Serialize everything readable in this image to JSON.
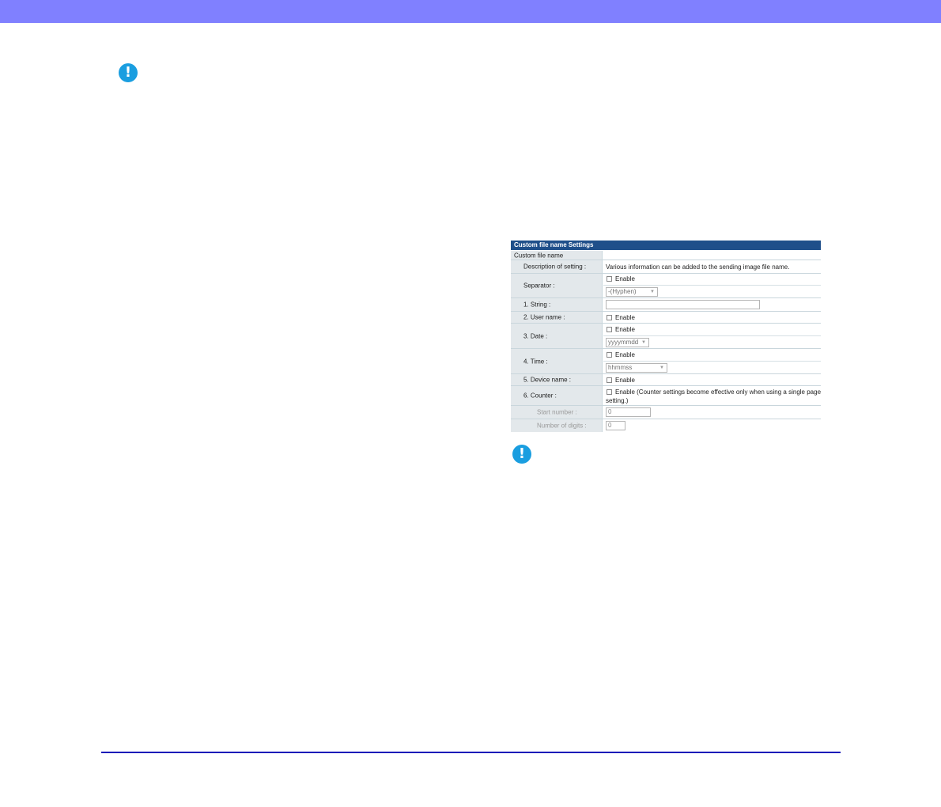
{
  "panel": {
    "title": "Custom file name Settings",
    "section_label": "Custom file name",
    "description_label": "Description of setting :",
    "description_text": "Various information can be added to the sending image file name.",
    "separator": {
      "label": "Separator :",
      "enable": "Enable",
      "selected": "-(Hyphen)"
    },
    "string": {
      "label": "1. String :",
      "value": ""
    },
    "user_name": {
      "label": "2. User name :",
      "enable": "Enable"
    },
    "date": {
      "label": "3. Date :",
      "enable": "Enable",
      "selected": "yyyymmdd"
    },
    "time": {
      "label": "4. Time :",
      "enable": "Enable",
      "selected": "hhmmss"
    },
    "device_name": {
      "label": "5. Device name :",
      "enable": "Enable"
    },
    "counter": {
      "label": "6. Counter :",
      "enable_line1": "Enable (Counter settings become effective only when using a single page",
      "enable_line2": "setting.)",
      "start_number_label": "Start number :",
      "start_number_value": "0",
      "digits_label": "Number of digits :",
      "digits_value": "0"
    }
  },
  "icons": {
    "note": "exclamation-icon"
  },
  "colors": {
    "top_bar": "#8080ff",
    "panel_header": "#1f4f8a",
    "note_icon": "#1a9ee0",
    "bottom_rule": "#1515b8"
  }
}
